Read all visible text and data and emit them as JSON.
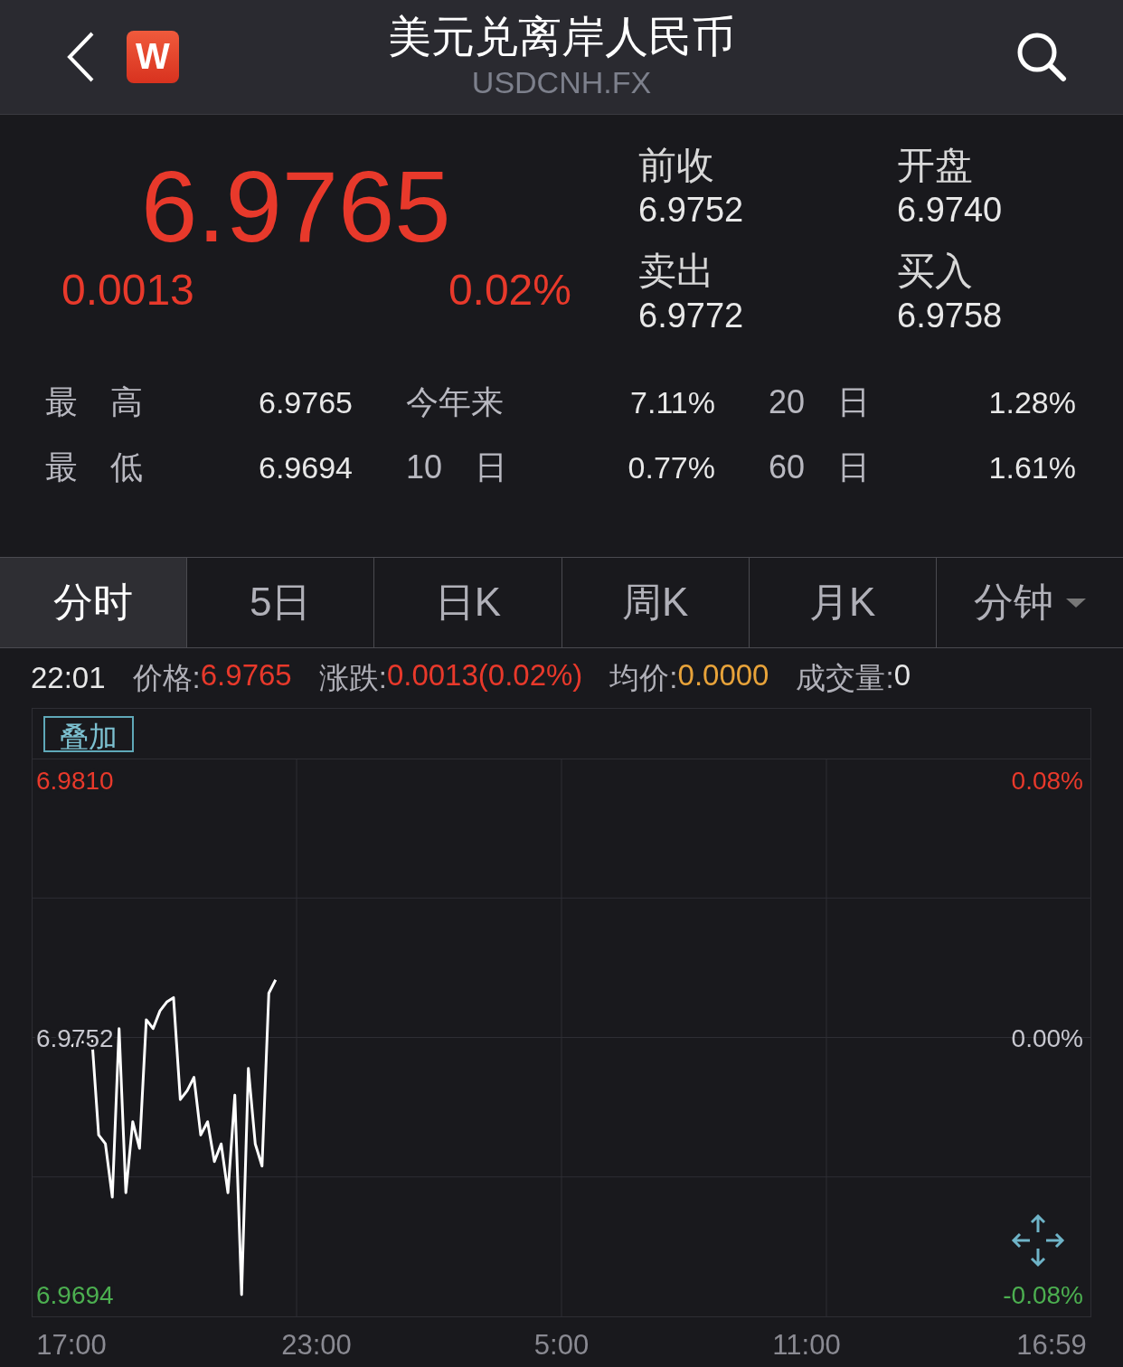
{
  "header": {
    "title": "美元兑离岸人民币",
    "symbol": "USDCNH.FX",
    "logo": "W"
  },
  "quote": {
    "price": "6.9765",
    "change": "0.0013",
    "change_pct": "0.02%",
    "color": "#e8392b"
  },
  "quote_fields": [
    {
      "label": "前收",
      "value": "6.9752"
    },
    {
      "label": "开盘",
      "value": "6.9740"
    },
    {
      "label": "卖出",
      "value": "6.9772"
    },
    {
      "label": "买入",
      "value": "6.9758"
    }
  ],
  "stats": [
    [
      {
        "label": "最　高",
        "value": "6.9765"
      },
      {
        "label": "今年来",
        "value": "7.11%"
      },
      {
        "label": "20　日",
        "value": "1.28%"
      }
    ],
    [
      {
        "label": "最　低",
        "value": "6.9694"
      },
      {
        "label": "10　日",
        "value": "0.77%"
      },
      {
        "label": "60　日",
        "value": "1.61%"
      }
    ]
  ],
  "tabs": [
    {
      "label": "分时",
      "selected": true,
      "dropdown": false
    },
    {
      "label": "5日",
      "selected": false,
      "dropdown": false
    },
    {
      "label": "日K",
      "selected": false,
      "dropdown": false
    },
    {
      "label": "周K",
      "selected": false,
      "dropdown": false
    },
    {
      "label": "月K",
      "selected": false,
      "dropdown": false
    },
    {
      "label": "分钟",
      "selected": false,
      "dropdown": true
    }
  ],
  "info_bar": {
    "time": "22:01",
    "items": [
      {
        "label": "价格:",
        "value": "6.9765",
        "color": "#e8392b"
      },
      {
        "label": "涨跌:",
        "value": "0.0013(0.02%)",
        "color": "#e8392b"
      },
      {
        "label": "均价:",
        "value": "0.0000",
        "color": "#e8a33a"
      },
      {
        "label": "成交量:",
        "value": "0",
        "color": "#e6e6e6"
      }
    ]
  },
  "chart": {
    "overlay_button": "叠加",
    "percent_labels": [
      "0.08%",
      "0.00%",
      "-0.08%"
    ],
    "chart_data": {
      "type": "line",
      "categories": [
        "17:00",
        null,
        null,
        null,
        null,
        null,
        null,
        null,
        null,
        null,
        null,
        null,
        null,
        null,
        null,
        null,
        null,
        null,
        null,
        null,
        null,
        null,
        null,
        null,
        null,
        null,
        null,
        null,
        null,
        null,
        null,
        null,
        null,
        null,
        null,
        null,
        "23:00",
        null,
        null,
        null,
        null,
        null,
        null,
        null,
        null,
        null,
        null,
        null,
        null,
        null,
        null,
        null,
        null,
        null,
        null,
        null,
        null,
        null,
        null,
        null,
        null,
        null,
        null,
        null,
        null,
        null,
        null,
        null,
        null,
        null,
        null,
        null,
        "5:00",
        null,
        null,
        null,
        null,
        null,
        null,
        null,
        null,
        null,
        null,
        null,
        null,
        null,
        null,
        null,
        null,
        null,
        null,
        null,
        null,
        null,
        null,
        null,
        null,
        null,
        null,
        null,
        null,
        null,
        null,
        null,
        null,
        null,
        null,
        null,
        "11:00",
        null,
        null,
        null,
        null,
        null,
        null,
        null,
        null,
        null,
        null,
        null,
        null,
        null,
        null,
        null,
        null,
        null,
        null,
        null,
        null,
        null,
        null,
        null,
        null,
        null,
        null,
        null,
        null,
        null,
        null,
        null,
        null,
        null,
        null,
        null,
        "16:59"
      ],
      "series": [
        {
          "color": "#ffffff",
          "values": [
            6.975,
            6.9751,
            6.9751,
            6.9752,
            6.973,
            6.9728,
            6.9716,
            6.9754,
            6.9717,
            6.9733,
            6.9727,
            6.9756,
            6.9754,
            6.9758,
            6.976,
            6.9761,
            6.9738,
            6.974,
            6.9743,
            6.973,
            6.9733,
            6.9724,
            6.9728,
            6.9717,
            6.9739,
            6.9694,
            6.9745,
            6.9728,
            6.9723,
            6.9762,
            6.9765,
            null,
            null,
            null,
            null,
            null,
            null,
            null,
            null,
            null,
            null,
            null,
            null,
            null,
            null,
            null,
            null,
            null,
            null,
            null,
            null,
            null,
            null,
            null,
            null,
            null,
            null,
            null,
            null,
            null,
            null,
            null,
            null,
            null,
            null,
            null,
            null,
            null,
            null,
            null,
            null,
            null,
            null,
            null,
            null,
            null,
            null,
            null,
            null,
            null,
            null,
            null,
            null,
            null,
            null,
            null,
            null,
            null,
            null,
            null,
            null,
            null,
            null,
            null,
            null,
            null,
            null,
            null,
            null,
            null,
            null,
            null,
            null,
            null,
            null,
            null,
            null,
            null,
            null,
            null,
            null,
            null,
            null,
            null,
            null,
            null,
            null,
            null,
            null,
            null,
            null,
            null,
            null,
            null,
            null,
            null,
            null,
            null,
            null,
            null,
            null,
            null,
            null,
            null,
            null,
            null,
            null,
            null,
            null,
            null,
            null,
            null,
            null,
            null,
            null
          ]
        }
      ],
      "ylim": [
        6.96891,
        6.98149
      ],
      "yticks": [
        {
          "value": 6.981,
          "label": "6.9810"
        },
        {
          "value": 6.9752,
          "label": "6.9752"
        },
        {
          "value": 6.9694,
          "label": "6.9694"
        }
      ]
    }
  }
}
